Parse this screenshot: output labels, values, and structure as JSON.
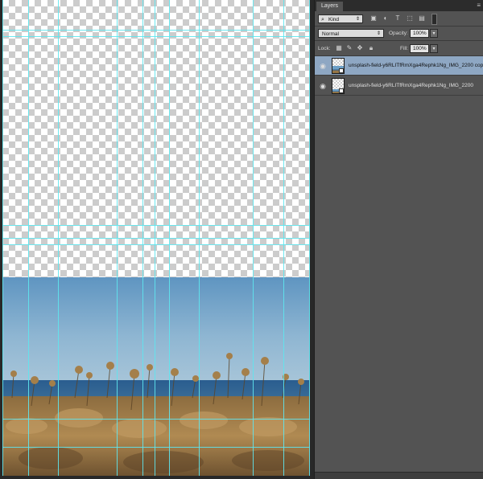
{
  "layers_panel": {
    "tab_label": "Layers",
    "menu_icon": "panel-menu-icon",
    "filter": {
      "search_icon": "magnifier-icon",
      "kind_value": "Kind",
      "filter_icons": [
        "image-filter-icon",
        "adjustment-filter-icon",
        "type-filter-icon",
        "shape-filter-icon",
        "smart-object-filter-icon",
        "filter-toggle-icon"
      ]
    },
    "blend_mode": "Normal",
    "opacity_label": "Opacity:",
    "opacity_value": "100%",
    "lock_label": "Lock:",
    "lock_icons": [
      "lock-transparent-pixels-icon",
      "lock-image-pixels-icon",
      "lock-position-icon",
      "lock-all-icon"
    ],
    "fill_label": "Fill:",
    "fill_value": "100%",
    "layers": [
      {
        "name": "unsplash-field-y6RLITfRmXga4Rephk1Ng_IMG_2200 copy",
        "selected": true,
        "visible": true
      },
      {
        "name": "unsplash-field-y6RLITfRmXga4Rephk1Ng_IMG_2200",
        "selected": false,
        "visible": true
      }
    ]
  },
  "colors": {
    "guide": "#5ee6ee",
    "panel_bg": "#535353",
    "selected_layer": "#8ea7c3",
    "workspace": "#282828"
  }
}
